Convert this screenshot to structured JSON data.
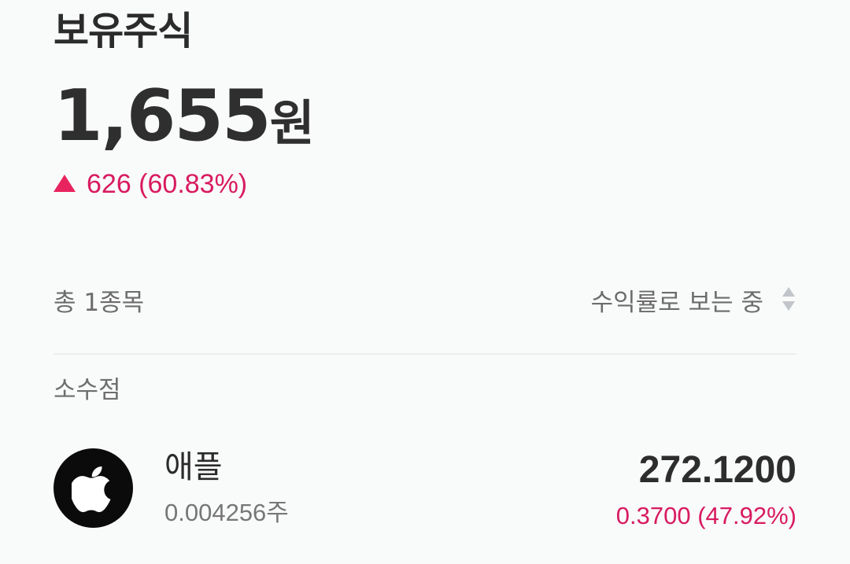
{
  "header": {
    "title": "보유주식"
  },
  "portfolio": {
    "total_value": "1,655",
    "total_unit": "원",
    "change_icon": "triangle-up-icon",
    "change_text": "626 (60.83%)",
    "change_color": "#d81b60"
  },
  "summary": {
    "count_text": "총 1종목",
    "sort_label": "수익률로 보는 중",
    "sort_icon": "sort-updown-icon"
  },
  "sections": [
    {
      "label": "소수점",
      "stocks": [
        {
          "name": "애플",
          "icon": "apple-logo-icon",
          "quantity": "0.004256주",
          "price": "272.1200",
          "change": "0.3700 (47.92%)"
        }
      ]
    }
  ]
}
